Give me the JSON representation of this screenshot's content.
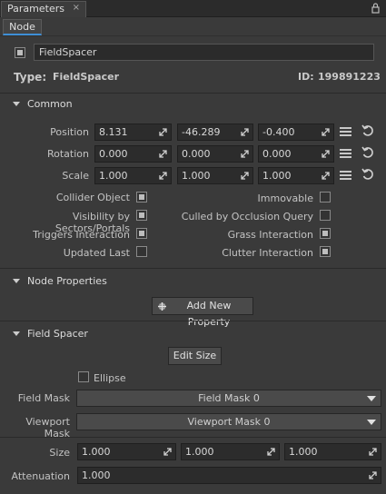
{
  "window": {
    "tab_title": "Parameters",
    "close_glyph": "×"
  },
  "subtabs": {
    "node": "Node"
  },
  "node": {
    "name": "FieldSpacer",
    "type_label": "Type:",
    "type_value": "FieldSpacer",
    "id_label": "ID:",
    "id_value": "199891223"
  },
  "common": {
    "title": "Common",
    "position": {
      "label": "Position",
      "x": "8.131",
      "y": "-46.289",
      "z": "-0.400"
    },
    "rotation": {
      "label": "Rotation",
      "x": "0.000",
      "y": "0.000",
      "z": "0.000"
    },
    "scale": {
      "label": "Scale",
      "x": "1.000",
      "y": "1.000",
      "z": "1.000"
    },
    "flags": {
      "collider_object": "Collider Object",
      "immovable": "Immovable",
      "visibility_by_sectors": "Visibility by Sectors/Portals",
      "culled_by_occlusion": "Culled by Occlusion Query",
      "triggers_interaction": "Triggers Interaction",
      "grass_interaction": "Grass Interaction",
      "updated_last": "Updated Last",
      "clutter_interaction": "Clutter Interaction"
    }
  },
  "node_properties": {
    "title": "Node Properties",
    "add_button": "Add New Property"
  },
  "field_spacer": {
    "title": "Field Spacer",
    "edit_size_button": "Edit Size",
    "ellipse_label": "Ellipse",
    "field_mask_label": "Field Mask",
    "field_mask_value": "Field Mask 0",
    "viewport_mask_label": "Viewport Mask",
    "viewport_mask_value": "Viewport Mask 0",
    "size_label": "Size",
    "size_x": "1.000",
    "size_y": "1.000",
    "size_z": "1.000",
    "attenuation_label": "Attenuation",
    "attenuation_value": "1.000"
  },
  "colors": {
    "accent": "#3e8fd6",
    "background": "#3a3a3a",
    "field": "#2c2c2c"
  }
}
